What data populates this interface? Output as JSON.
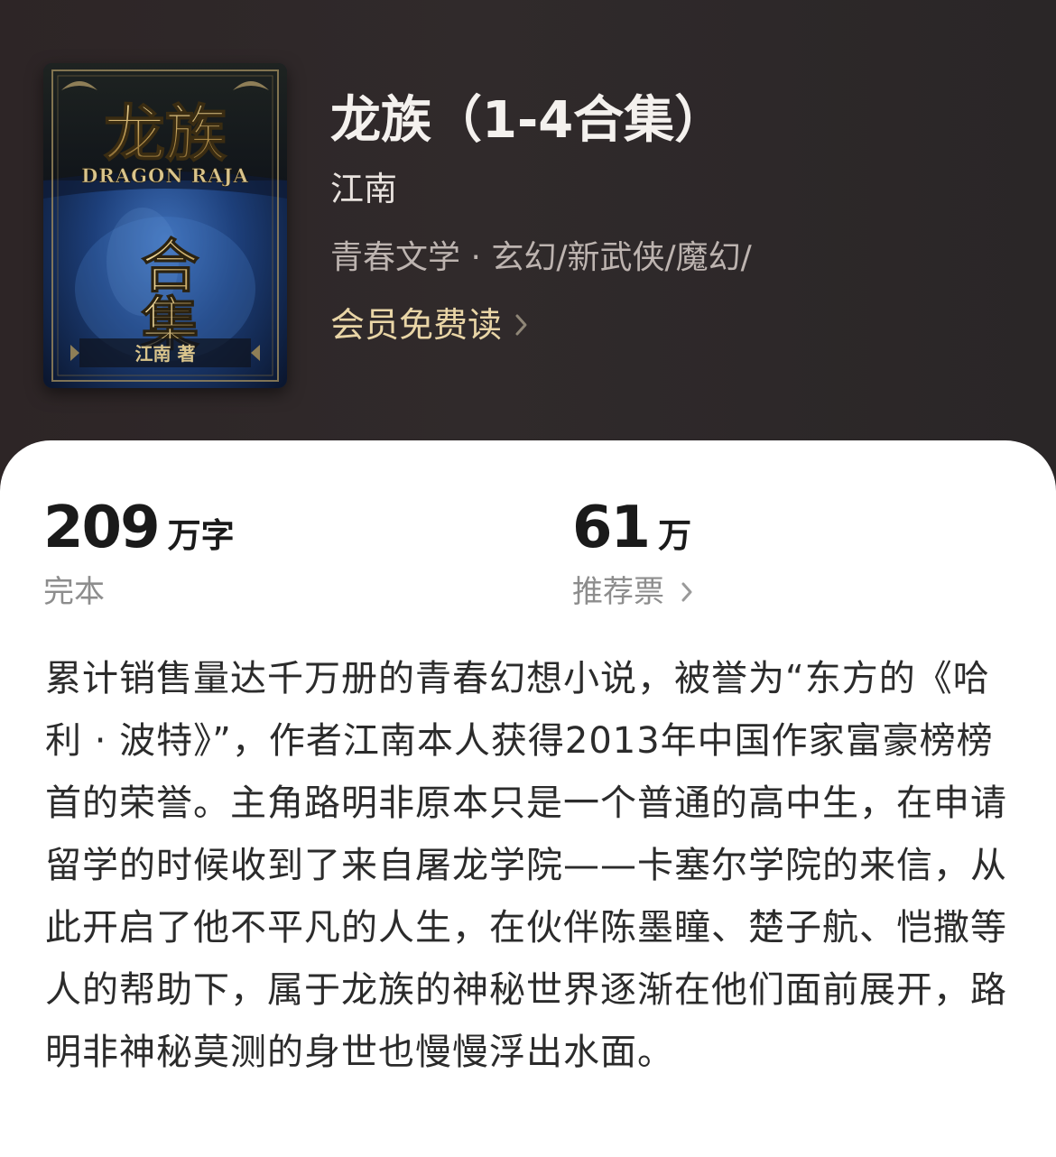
{
  "book": {
    "title": "龙族（1-4合集）",
    "author": "江南",
    "genres": "青春文学 · 玄幻/新武侠/魔幻/",
    "member_label": "会员免费读",
    "cover": {
      "title_cn": "龙族",
      "title_en": "DRAGON RAJA",
      "subtitle": "合集",
      "author_line": "江南 著"
    }
  },
  "stats": {
    "word_count": "209",
    "word_unit": "万字",
    "status": "完本",
    "votes": "61",
    "votes_unit": "万",
    "votes_label": "推荐票"
  },
  "description": "累计销售量达千万册的青春幻想小说，被誉为“东方的《哈利 · 波特》”，作者江南本人获得2013年中国作家富豪榜榜首的荣誉。主角路明非原本只是一个普通的高中生，在申请留学的时候收到了来自屠龙学院——卡塞尔学院的来信，从此开启了他不平凡的人生，在伙伴陈墨瞳、楚子航、恺撒等人的帮助下，属于龙族的神秘世界逐渐在他们面前展开，路明非神秘莫测的身世也慢慢浮出水面。",
  "colors": {
    "header_bg": "#2d2526",
    "member_gold": "#e9d5a6",
    "label_gray": "#8d8d8d"
  },
  "icons": {
    "member_arrow": "chevron-right-icon",
    "votes_arrow": "chevron-right-icon"
  }
}
